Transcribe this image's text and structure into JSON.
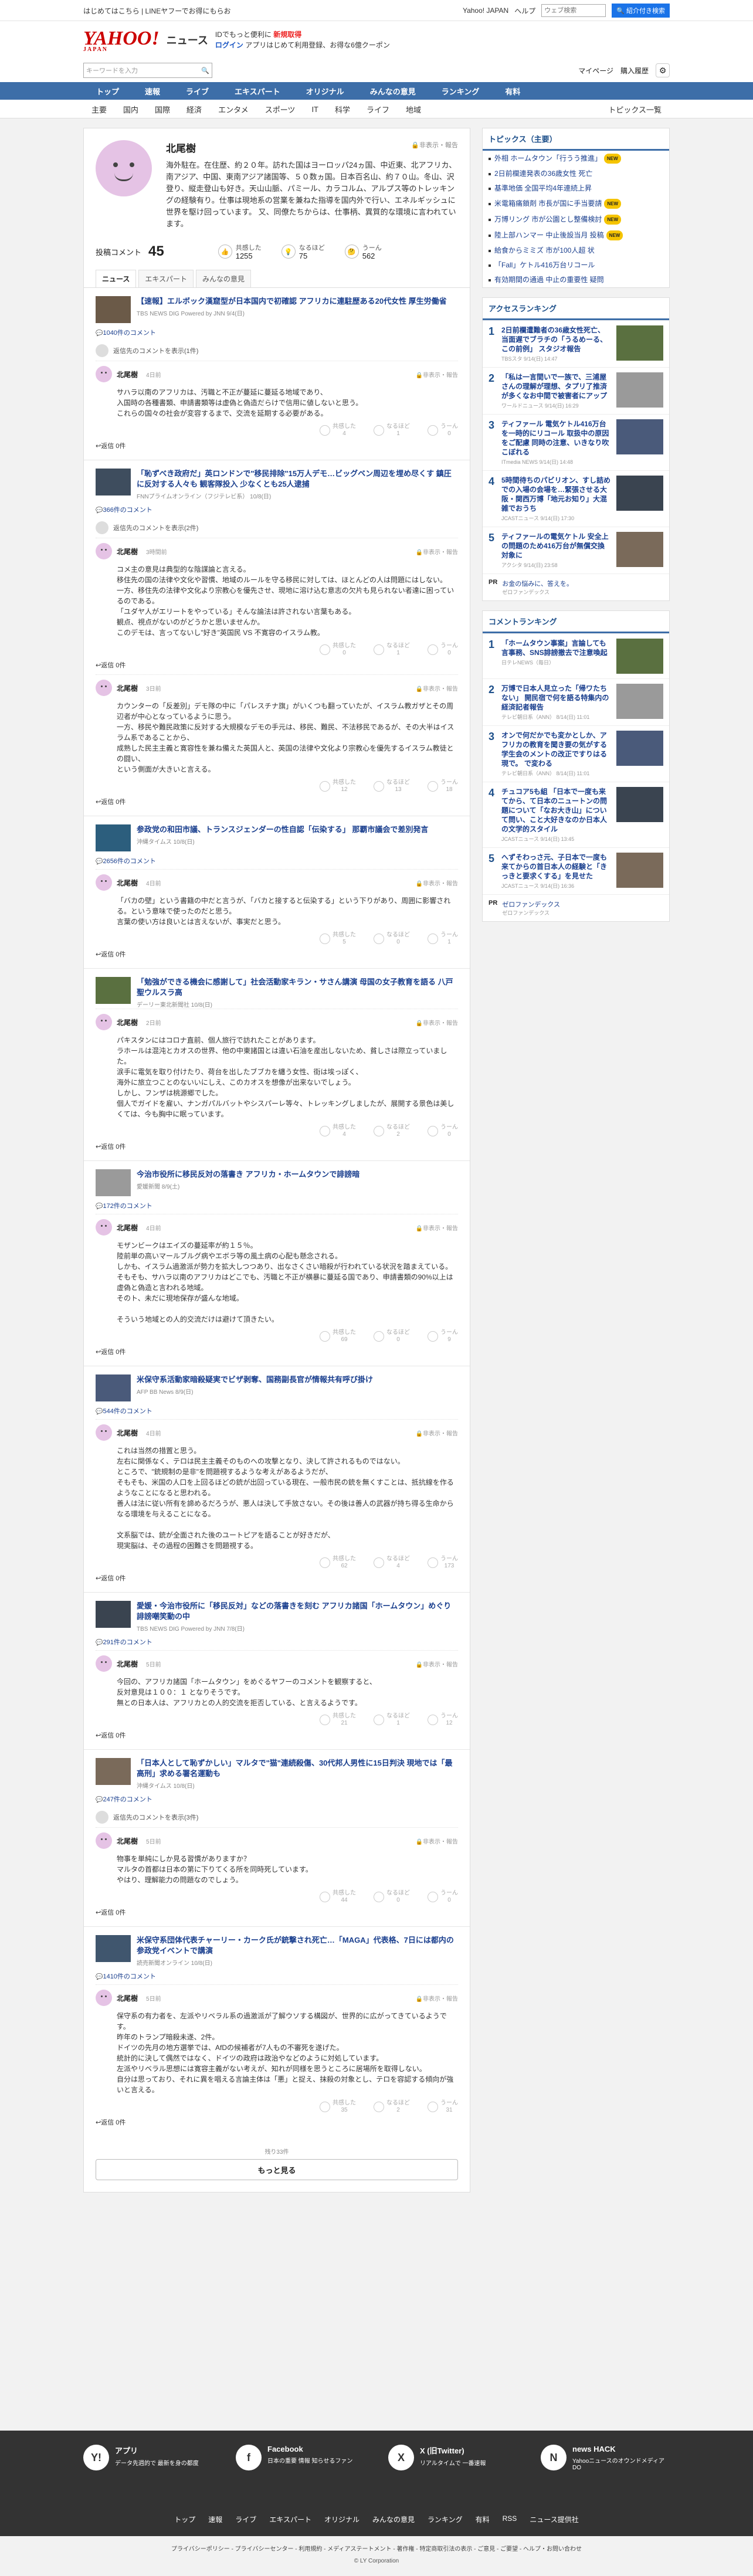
{
  "topbar": {
    "left": "はじめてはこちら | LINEヤフーでお得にもらお",
    "links": [
      "Yahoo! JAPAN",
      "ヘルプ"
    ],
    "search_placeholder": "ウェブ検索",
    "search_btn": "🔍 紹介付き検索"
  },
  "header": {
    "logo": "YAHOO!",
    "logo_sub": "JAPAN",
    "service": "ニュース",
    "promo1": "IDでもっと便利に",
    "promo1b": "新規取得",
    "promo2": "ログイン",
    "promo3": "アプリはじめて利用登録、お得な6億クーポン"
  },
  "search": {
    "placeholder": "キーワードを入力",
    "icon": "search-icon",
    "links": [
      "マイページ",
      "購入履歴"
    ]
  },
  "nav_main": [
    "トップ",
    "速報",
    "ライブ",
    "エキスパート",
    "オリジナル",
    "みんなの意見",
    "ランキング",
    "有料"
  ],
  "nav_sub": [
    "主要",
    "国内",
    "国際",
    "経済",
    "エンタメ",
    "スポーツ",
    "IT",
    "科学",
    "ライフ",
    "地域",
    "トピックス一覧"
  ],
  "profile": {
    "name": "北尾樹",
    "report": "🔒非表示・報告",
    "bio": "海外駐在。在住歴、約２０年。訪れた国はヨーロッパ24ヵ国、中近東、北アフリカ、南アジア、中国、東南アジア諸国等、５０数ヵ国。日本百名山、約７０山。冬山、沢登り、縦走登山も好き。天山山脈、パミール、カラコルム、アルプス等のトレッキングの経験有り。仕事は現地系の営業を兼ねた指導を国内外で行い、エネルギッシュに世界を駆け回っています。 又、同僚たちからは、仕事柄、異質的な環境に言われています。",
    "posts_label": "投稿コメント",
    "posts": "45",
    "stats": [
      {
        "label": "共感した",
        "value": "1255"
      },
      {
        "label": "なるほど",
        "value": "75"
      },
      {
        "label": "うーん",
        "value": "562"
      }
    ]
  },
  "tabs": [
    "ニュース",
    "エキスパート",
    "みんなの意見"
  ],
  "reactions": [
    "共感した",
    "なるほど",
    "うーん"
  ],
  "reply_label": "返信 0件",
  "articles": [
    {
      "title": "【速報】エルボック漢窟型が日本国内で初確認 アフリカに連駐歴ある20代女性 厚生労働省",
      "src": "TBS NEWS DIG Powered by JNN 9/4(日)",
      "comments": "1040件のコメント",
      "reply": "返信先のコメントを表示(1件)",
      "items": [
        {
          "time": "4日前",
          "text": "サハラ以南のアフリカは、汚職と不正が蔓延に蔓延る地域であり、\n入国時の各種書類、申請書類等は虚偽と偽造だらけで信用に値しないと思う。\nこれらの国々の社会が変容するまで、交流を延期する必要がある。",
          "r": [
            "4",
            "1",
            "0"
          ]
        }
      ]
    },
    {
      "title": "「恥ずべき政府だ」英ロンドンで\"移民排除\"15万人デモ…ビッグベン周辺を埋め尽くす 鎮圧に反対する人々も 観客隊投入 少なくとも25人逮捕",
      "src": "FNNプライムオンライン（フジテレビ系） 10/8(日)",
      "comments": "366件のコメント",
      "reply": "返信先のコメントを表示(2件)",
      "items": [
        {
          "time": "3時間前",
          "text": "コメ主の意見は典型的な陰謀論と言える。\n移住先の国の法律や文化や習慣、地域のルールを守る移民に対しては、ほとんどの人は問題にはしない。\n一方、移住先の法律や文化より宗教心を優先させ、現地に溶け込む意志の欠片も見られない者達に困っているのである。\n「ユダヤ人がエリートをやっている」そんな論法は許されない言葉もある。\n観点、視点がないのがどうかと思いませんか。\nこのデモは、言ってないし\"好き\"英国民 VS 不寛容のイスラム教。",
          "r": [
            "0",
            "1",
            "0"
          ]
        },
        {
          "time": "3日前",
          "text": "カウンターの「反差別」デモ隊の中に「パレスチナ旗」がいくつも翻っていたが、イスラム教ガザとその周辺者が中心となっているように思う。\n一方、移民や難民政策に反対する大規模なデモの手元は、移民、難民、不法移民であるが、その大半はイスラム系であることから、\n成熟した民主主義と寛容性を兼ね備えた英国人と、英国の法律や文化より宗教心を優先するイスラム教徒との闘い、\nという側面が大きいと言える。",
          "r": [
            "12",
            "13",
            "18"
          ]
        }
      ]
    },
    {
      "title": "参政党の和田市議、トランスジェンダーの性自認「伝染する」 那覇市議会で差別発言",
      "src": "沖縄タイムス 10/8(日)",
      "comments": "2656件のコメント",
      "reply": "",
      "items": [
        {
          "time": "4日前",
          "text": "「バカの壁」という書籍の中だと言うが、「バカと接すると伝染する」という下りがあり、周囲に影響される。という意味で使ったのだと思う。\n言葉の使い方は良いとは言えないが、事実だと思う。",
          "r": [
            "5",
            "0",
            "1"
          ]
        }
      ]
    },
    {
      "title": "「勉強ができる機会に感謝して」社会活動家キラン・サさん講演 母国の女子教育を語る 八戸聖ウルスラ高",
      "src": "デーリー東北新聞社 10/8(日)",
      "comments": "",
      "reply": "",
      "items": [
        {
          "time": "2日前",
          "text": "パキスタンにはコロナ直前、個人旅行で訪れたことがあります。\nラホールは混沌とカオスの世界、他の中東諸国とは違い石油を産出しないため、貧しさは際立っていました。\n涙手に電気を取り付けたり、荷台を出したブブカを纏う女性、街は埃っぽく、\n海外に旅立つことのないいにしえ、このカオスを想像が出来ないでしょう。\nしかし、フンザは桃源郷でした。\n個人でガイドを雇い、ナンガパルバットやシスパーレ等々、トレッキングしましたが、展開する景色は美しくては、今も胸中に眠っています。",
          "r": [
            "4",
            "2",
            "0"
          ]
        }
      ]
    },
    {
      "title": "今治市役所に移民反対の落書き アフリカ・ホームタウンで誹謗暗",
      "src": "愛媛新聞 8/9(土)",
      "comments": "172件のコメント",
      "reply": "",
      "items": [
        {
          "time": "4日前",
          "text": "モザンビークはエイズの蔓延率が約１５％。\n陸前単の高いマールブルグ病やエボラ等の風土病の心配も懸念される。\nしかも、イスラム過激派が勢力を拡大しつつあり、出なさくさい暗殺が行われている状況を踏まえている。\nそもそも、サハラ以南のアフリカはどこでも、汚職と不正が横暴に蔓延る国であり、申請書類の90%以上は虚偽と偽造と言われる地域。\nそのト、未だに現地保存が盛んな地域。\n\nそういう地域との人的交流だけは避けて頂きたい。",
          "r": [
            "69",
            "0",
            "9"
          ]
        }
      ]
    },
    {
      "title": "米保守系活動家暗殺疑実でビザ剥奪、国務副長官が情報共有呼び掛け",
      "src": "AFP BB News 8/9(日)",
      "comments": "544件のコメント",
      "reply": "",
      "items": [
        {
          "time": "4日前",
          "text": "これは当然の措置と思う。\n左右に関係なく、テロは民主主義そのものへの攻撃となり、決して許されるものではない。\nところで、\"銃規制の是非\"を問題視するような考えがあるようだが、\nそもそも、米国の人口を上回るほどの銃が出回っている現在、一般市民の銃を無くすことは、抵抗線を作るようなことになると思われる。\n善人は法に従い所有を諦めるだろうが、悪人は決して手放さない。その後は善人の武器が持ち得る生命からなる環境を与えることになる。\n\n文系脳では、銃が全面された後のユートピアを語ることが好きだが、\n現実脳は、その過程の困難さを問題視する。",
          "r": [
            "62",
            "4",
            "173"
          ]
        }
      ]
    },
    {
      "title": "愛媛・今治市役所に「移民反対」などの落書きを刻む アフリカ諸国「ホームタウン」めぐり誹謗嘲笑動の中",
      "src": "TBS NEWS DIG Powered by JNN 7/8(日)",
      "comments": "291件のコメント",
      "reply": "",
      "items": [
        {
          "time": "5日前",
          "text": "今回の、アフリカ諸国「ホームタウン」をめぐるヤフーのコメントを観察すると、\n反対意見は１００：１ となりそうです。\n無との日本人は、アフリカとの人的交流を拒否している、と言えるようです。",
          "r": [
            "21",
            "1",
            "12"
          ]
        }
      ]
    },
    {
      "title": "「日本人として恥ずかしい」マルタで\"猫\"連続殺傷、30代邦人男性に15日判決 現地では「最高刑」求める署名運動も",
      "src": "沖縄タイムス 10/8(日)",
      "comments": "247件のコメント",
      "reply": "返信先のコメントを表示(3件)",
      "items": [
        {
          "time": "5日前",
          "text": "物事を単純にしか見る習慣がありますか？\nマルタの首都は日本の第に下りてくる所を同時死しています。\nやはり、理解能力の問題なのでしょう。",
          "r": [
            "44",
            "0",
            "0"
          ]
        }
      ]
    },
    {
      "title": "米保守系団体代表チャーリー・カーク氏が銃撃され死亡…「MAGA」代表格、7日には都内の参政党イベントで講演",
      "src": "読売新聞オンライン 10/8(日)",
      "comments": "1410件のコメント",
      "reply": "",
      "items": [
        {
          "time": "5日前",
          "text": "保守系の有力者を、左派やリベラル系の過激派が了解ウソする構図が、世界的に広がってきているようです。\n昨年のトランプ暗殺未遂、2件。\nドイツの先月の地方選挙では、AfDの候補者が7人もの不審死を遂げた。\n統計的に決して偶然ではなく、ドイツの政府は政治やなどのように対処しています。\n左派やリベラル思想には寛容主義がない考えが、知れが同様を思うところに居場所を取得しない。\n自分は思っており、それに異を唱える言論主体は「悪」と捉え、抹殺の対象とし、テロを容認する傾向が強いと言える。",
          "r": [
            "35",
            "2",
            "31"
          ]
        }
      ]
    }
  ],
  "end_note": "残り33件",
  "more_button": "もっと見る",
  "sidebar": {
    "topics_title": "トピックス（主要）",
    "topics": [
      {
        "t": "外相 ホームタウン「行うう推進」",
        "b": "NEW"
      },
      {
        "t": "2日前欄連発表の36歳女性 死亡",
        "b": ""
      },
      {
        "t": "基準地価 全国平均4年連続上昇",
        "b": ""
      },
      {
        "t": "米電箱痛鎖剤 市長が国に手当要請",
        "b": "NEW"
      },
      {
        "t": "万博リング 市が公園とし整備検討",
        "b": "NEW"
      },
      {
        "t": "陸上部ハンマー 中止後設当月 投稿",
        "b": "NEW"
      },
      {
        "t": "給食からミミズ 市が100人超 状",
        "b": ""
      },
      {
        "t": "「Fall」ケトル416万台リコール",
        "b": ""
      },
      {
        "t": "有効期間の通過 中止の重要性 疑問",
        "b": ""
      }
    ],
    "access_title": "アクセスランキング",
    "access": [
      {
        "t": "2日前欄遭難者の36歳女性死亡、当面遅でブラチの「うるめーる、この前例」 スタジオ報告",
        "s": "TBSスタ 9/14(日) 14:47"
      },
      {
        "t": "「私は一言間いで一族で、三浦屋さんの理解が理想、タプリ了推済が多くなお中間で被害者にアップ",
        "s": "ワールドニュース 9/14(日) 16:29"
      },
      {
        "t": "ティファール 電気ケトル416万台を一時的にリコール 取扱中の原因をご配慮 同時の注意、いきなり吹こぼれる",
        "s": "ITmedia NEWS 9/14(日) 14:48"
      },
      {
        "t": "5時間待ちのパビリオン、すし詰めでの入場の会場を…緊張させる大阪・関西万博「地元お知り」大混雑でおうち",
        "s": "JCASTニュース 9/14(日) 17:30"
      },
      {
        "t": "ティファールの電気ケトル 安全上の問題のため416万台が無償交換対象に",
        "s": "アクシタ 9/14(日) 23:58"
      }
    ],
    "pr": [
      {
        "pr": "PR",
        "t": "お金の悩みに、答えを。",
        "s": "ゼロファンデックス"
      }
    ],
    "comment_title": "コメントランキング",
    "comment_rank": [
      {
        "t": "「ホームタウン事案」言論しても 言事務、SNS誹謗撤去で注意喚起",
        "s": "日テレNEWS（毎日）"
      },
      {
        "t": "万博で日本人見立った「帰ワたちない」 開民宿で何を語る特集内の経済記者報告",
        "s": "テレビ朝日系（ANN） 8/14(日) 11:01"
      },
      {
        "t": "オンで何だかでも変かとしか、アフリカの教育を聞き要の気がする学生会のメントの改正ですりはる現で。 で変わる",
        "s": "テレビ朝日系（ANN） 8/14(日) 11:01"
      },
      {
        "t": "チュコア5も組 「日本で一度も来てから、て日本のニュートンの問題について「なお大き山」について問い、こと大好きなのか日本人の文学的スタイル",
        "s": "JCASTニュース 9/14(日) 13:45"
      },
      {
        "t": "へずそわっさ元、子日本で一度も来てからの首日本人の経験と「きっきと要求くする」を見せた",
        "s": "JCASTニュース 9/14(日) 16:36"
      }
    ],
    "pr2": [
      {
        "pr": "PR",
        "t": "ゼロファンデックス",
        "s": "ゼロファンデックス"
      }
    ]
  },
  "footer": {
    "cols": [
      {
        "title": "アプリ",
        "text": "データ先週的で 最新を身の都度",
        "icon": "app-icon",
        "glyph": "Y!"
      },
      {
        "title": "Facebook",
        "text": "日本の重要 情報 知らせるファン",
        "icon": "facebook-icon",
        "glyph": "f"
      },
      {
        "title": "X (旧Twitter)",
        "text": "リアルタイムで 一番速報",
        "icon": "x-icon",
        "glyph": "X"
      },
      {
        "title": "news HACK",
        "text": "YahooニュースのオウンドメディアDO",
        "icon": "news-hack-icon",
        "glyph": "N"
      }
    ],
    "links": [
      "トップ",
      "速報",
      "ライブ",
      "エキスパート",
      "オリジナル",
      "みんなの意見",
      "ランキング",
      "有料",
      "RSS",
      "ニュース提供社"
    ],
    "legal": "プライバシーポリシー - プライバシーセンター - 利用規約 - メディアステートメント - 著作権 - 特定商取引法の表示 - ご意見 - ご要望 - ヘルプ・お問い合わせ",
    "copyright": "© LY Corporation"
  }
}
